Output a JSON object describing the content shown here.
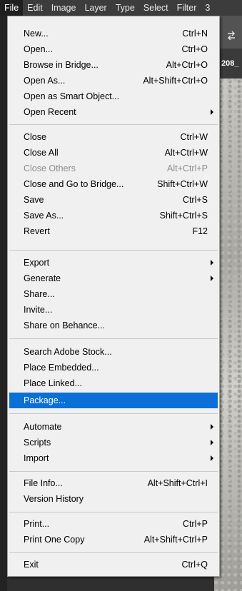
{
  "menubar": {
    "items": [
      "File",
      "Edit",
      "Image",
      "Layer",
      "Type",
      "Select",
      "Filter",
      "3"
    ]
  },
  "background": {
    "tab_label": "208_"
  },
  "file_menu": {
    "highlight_color": "#0a6fd6",
    "items": [
      {
        "label": "New...",
        "shortcut": "Ctrl+N"
      },
      {
        "label": "Open...",
        "shortcut": "Ctrl+O"
      },
      {
        "label": "Browse in Bridge...",
        "shortcut": "Alt+Ctrl+O"
      },
      {
        "label": "Open As...",
        "shortcut": "Alt+Shift+Ctrl+O"
      },
      {
        "label": "Open as Smart Object...",
        "shortcut": ""
      },
      {
        "label": "Open Recent",
        "shortcut": "",
        "submenu": true
      },
      {
        "label": "Close",
        "shortcut": "Ctrl+W"
      },
      {
        "label": "Close All",
        "shortcut": "Alt+Ctrl+W"
      },
      {
        "label": "Close Others",
        "shortcut": "Alt+Ctrl+P",
        "disabled": true
      },
      {
        "label": "Close and Go to Bridge...",
        "shortcut": "Shift+Ctrl+W"
      },
      {
        "label": "Save",
        "shortcut": "Ctrl+S"
      },
      {
        "label": "Save As...",
        "shortcut": "Shift+Ctrl+S"
      },
      {
        "label": "Revert",
        "shortcut": "F12"
      },
      {
        "label": "Export",
        "shortcut": "",
        "submenu": true
      },
      {
        "label": "Generate",
        "shortcut": "",
        "submenu": true
      },
      {
        "label": "Share...",
        "shortcut": ""
      },
      {
        "label": "Invite...",
        "shortcut": ""
      },
      {
        "label": "Share on Behance...",
        "shortcut": ""
      },
      {
        "label": "Search Adobe Stock...",
        "shortcut": ""
      },
      {
        "label": "Place Embedded...",
        "shortcut": ""
      },
      {
        "label": "Place Linked...",
        "shortcut": ""
      },
      {
        "label": "Package...",
        "shortcut": "",
        "highlighted": true
      },
      {
        "label": "Automate",
        "shortcut": "",
        "submenu": true
      },
      {
        "label": "Scripts",
        "shortcut": "",
        "submenu": true
      },
      {
        "label": "Import",
        "shortcut": "",
        "submenu": true
      },
      {
        "label": "File Info...",
        "shortcut": "Alt+Shift+Ctrl+I"
      },
      {
        "label": "Version History",
        "shortcut": ""
      },
      {
        "label": "Print...",
        "shortcut": "Ctrl+P"
      },
      {
        "label": "Print One Copy",
        "shortcut": "Alt+Shift+Ctrl+P"
      },
      {
        "label": "Exit",
        "shortcut": "Ctrl+Q"
      }
    ]
  }
}
